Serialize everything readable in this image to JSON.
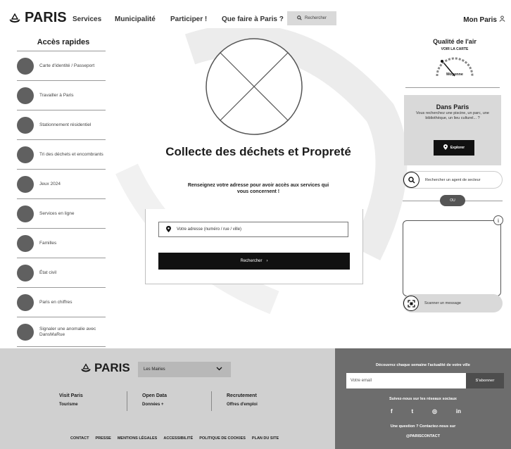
{
  "header": {
    "logo_text": "PARIS",
    "nav": [
      "Services",
      "Municipalité",
      "Participer !",
      "Que faire à Paris ?"
    ],
    "search_label": "Rechercher",
    "account_label": "Mon Paris"
  },
  "quick_access": {
    "title": "Accès rapides",
    "items": [
      "Carte d'identité / Passeport",
      "Travailler à Paris",
      "Stationnement résidentiel",
      "Tri des déchets et encombrants",
      "Jeux 2024",
      "Services en ligne",
      "Familles",
      "État civil",
      "Paris en chiffres",
      "Signaler une anomalie avec DansMaRue"
    ]
  },
  "hero": {
    "title": "Collecte des déchets et Propreté",
    "subtitle": "Renseignez votre adresse pour avoir accès aux services qui vous concernent !",
    "address_placeholder": "Votre adresse (numéro / rue / ville)",
    "submit_label": "Rechercher"
  },
  "air_quality": {
    "title": "Qualité de l'air",
    "link": "VOIR LA CARTE",
    "level": "Moyenne"
  },
  "dans_paris": {
    "title": "Dans Paris",
    "text": "Vous recherchez une piscine, un parc, une bibliothèque, un lieu culturel... ?",
    "button": "Explorer"
  },
  "agent": {
    "label": "Rechercher un agent de secteur"
  },
  "divider_pill": "OU",
  "scan": {
    "label": "Scanner un message"
  },
  "footer": {
    "logo_text": "PARIS",
    "select_value": "Les Mairies",
    "columns": [
      {
        "title": "Visit Paris",
        "sub": "Tourisme"
      },
      {
        "title": "Open Data",
        "sub": "Données +"
      },
      {
        "title": "Recrutement",
        "sub": "Offres d'emploi"
      }
    ],
    "links": [
      "CONTACT",
      "PRESSE",
      "MENTIONS LÉGALES",
      "ACCESSIBILITÉ",
      "POLITIQUE DE COOKIES",
      "PLAN DU SITE"
    ],
    "newsletter_title": "Découvrez chaque semaine l'actualité de votre ville",
    "newsletter_placeholder": "Votre email",
    "newsletter_button": "S'abonner",
    "social_title": "Suivez-nous sur les réseaux sociaux",
    "social": [
      "f",
      "t",
      "◎",
      "in"
    ],
    "question_title": "Une question ? Contactez-nous sur",
    "question_link": "@PARISCONTACT"
  }
}
